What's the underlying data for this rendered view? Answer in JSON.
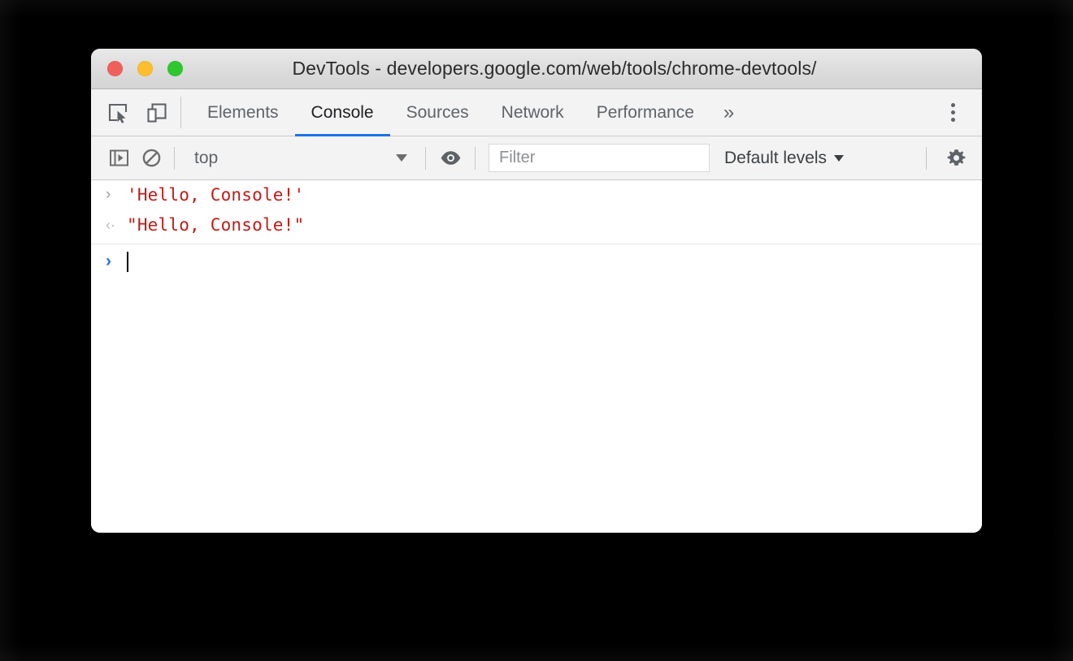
{
  "window": {
    "title": "DevTools - developers.google.com/web/tools/chrome-devtools/",
    "traffic_lights": [
      {
        "name": "close",
        "color": "#f0605b"
      },
      {
        "name": "minimize",
        "color": "#fcbd2e"
      },
      {
        "name": "maximize",
        "color": "#2ec72e"
      }
    ]
  },
  "toolbar": {
    "inspect_icon": "inspect-element-icon",
    "device_icon": "device-toolbar-icon",
    "overflow_label": "»",
    "menu_icon": "kebab-menu-icon"
  },
  "tabs": [
    {
      "label": "Elements",
      "active": false
    },
    {
      "label": "Console",
      "active": true
    },
    {
      "label": "Sources",
      "active": false
    },
    {
      "label": "Network",
      "active": false
    },
    {
      "label": "Performance",
      "active": false
    }
  ],
  "console_toolbar": {
    "sidebar_icon": "console-sidebar-toggle-icon",
    "clear_icon": "clear-console-icon",
    "context_value": "top",
    "eye_icon": "live-expression-eye-icon",
    "filter_value": "",
    "filter_placeholder": "Filter",
    "levels_label": "Default levels",
    "settings_icon": "settings-gear-icon"
  },
  "console": {
    "entries": [
      {
        "marker": "›",
        "type": "input",
        "text": "'Hello, Console!'"
      },
      {
        "marker": "‹·",
        "type": "result",
        "text": "\"Hello, Console!\""
      }
    ],
    "prompt_marker": "›",
    "prompt_value": ""
  },
  "colors": {
    "accent": "#1a73e8",
    "string": "#c41a16",
    "toolbar_bg": "#f3f3f3",
    "titlebar_bg": "#dcdcdc",
    "body_bg": "#ffffff",
    "backdrop": "#000000"
  }
}
